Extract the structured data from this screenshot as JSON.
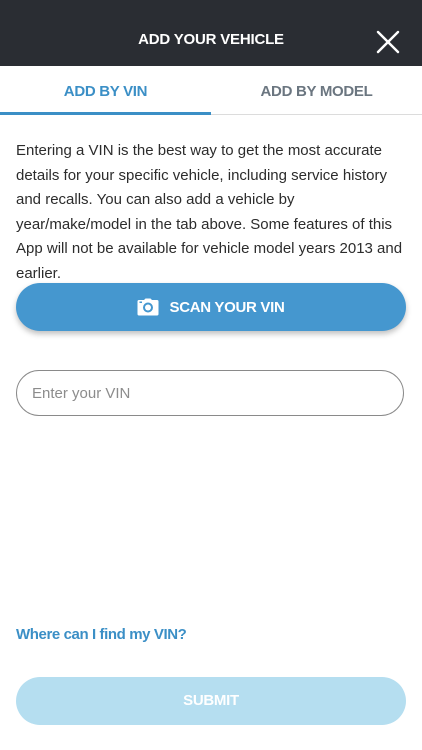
{
  "header": {
    "title": "ADD YOUR VEHICLE",
    "close_icon": "close-icon",
    "background_color": "#2a2d33"
  },
  "tabs": [
    {
      "label": "ADD BY VIN",
      "active": true
    },
    {
      "label": "ADD BY MODEL",
      "active": false
    }
  ],
  "description": "Entering a VIN is the best way to get the most accurate details for your specific vehicle, including service history and recalls. You can also add a vehicle by year/make/model in the tab above. Some features of this App will not be available for vehicle model years 2013 and earlier.",
  "scan_button": {
    "label": "SCAN YOUR VIN",
    "icon": "camera-icon",
    "color": "#4597cf"
  },
  "vin_input": {
    "placeholder": "Enter your VIN",
    "value": ""
  },
  "help_link": "Where can I find my VIN?",
  "submit_button": {
    "label": "SUBMIT",
    "enabled": false,
    "color": "#b5def0"
  },
  "accent_color": "#3b8fc6"
}
